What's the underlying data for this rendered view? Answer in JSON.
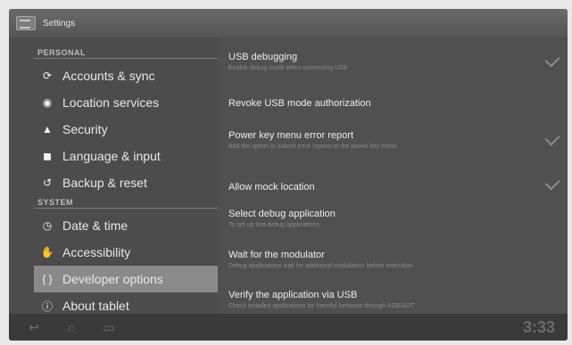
{
  "app": {
    "title": "Settings"
  },
  "sidebar": {
    "sections": [
      {
        "header": "PERSONAL"
      },
      {
        "header": "SYSTEM"
      }
    ],
    "items": [
      {
        "label": "Accounts & sync",
        "icon": "sync-icon"
      },
      {
        "label": "Location services",
        "icon": "location-icon"
      },
      {
        "label": "Security",
        "icon": "lock-icon"
      },
      {
        "label": "Language & input",
        "icon": "keyboard-icon"
      },
      {
        "label": "Backup & reset",
        "icon": "restore-icon"
      },
      {
        "label": "Date & time",
        "icon": "clock-icon"
      },
      {
        "label": "Accessibility",
        "icon": "hand-icon"
      },
      {
        "label": "Developer options",
        "icon": "braces-icon",
        "selected": true
      },
      {
        "label": "About tablet",
        "icon": "info-icon"
      }
    ]
  },
  "content": {
    "prefs": [
      {
        "title": "USB debugging",
        "summary": "Enable debug mode when connecting USB",
        "checked": true
      },
      {
        "title": "Revoke USB mode authorization",
        "summary": ""
      },
      {
        "title": "Power key menu error report",
        "summary": "Add the option to submit error reports to the power key menu",
        "checked": true
      },
      {
        "title": "Allow mock location",
        "summary": "",
        "checked": true
      },
      {
        "title": "Select debug application",
        "summary": "To set up test debug applications"
      },
      {
        "title": "Wait for the modulator",
        "summary": "Debug applications wait for additional modulators before execution"
      },
      {
        "title": "Verify the application via USB",
        "summary": "Check installed applications for harmful behavior through ADB/ADT"
      }
    ]
  },
  "statusbar": {
    "time": "3:33"
  },
  "colors": {
    "selected": "#8a8a8a",
    "background": "#4c4c4c"
  }
}
